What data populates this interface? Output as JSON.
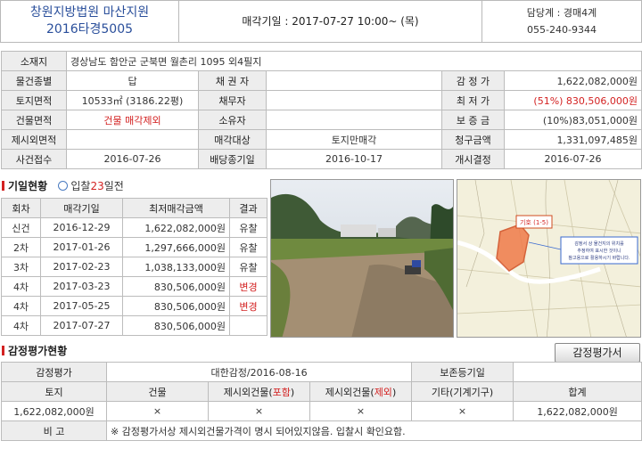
{
  "header": {
    "court": "창원지방법원 마산지원",
    "case_no": "2016타경5005",
    "sale_date": "매각기일 : 2017-07-27   10:00~ (목)",
    "dept": "담당계 : 경매4계",
    "phone": "055-240-9344"
  },
  "property": {
    "address_label": "소재지",
    "address": "경상남도 함안군 군북면 월촌리 1095 외4필지",
    "rows": [
      {
        "l1": "물건종별",
        "v1": "답",
        "l2": "채 권 자",
        "v2": "",
        "l3": "감 정 가",
        "v3": "1,622,082,000원"
      },
      {
        "l1": "토지면적",
        "v1": "10533㎡ (3186.22평)",
        "l2": "채무자",
        "v2": "",
        "l3": "최 저 가",
        "v3": "(51%) 830,506,000원"
      },
      {
        "l1": "건물면적",
        "v1": "건물 매각제외",
        "l2": "소유자",
        "v2": "",
        "l3": "보 증 금",
        "v3": "(10%)83,051,000원"
      },
      {
        "l1": "제시외면적",
        "v1": "",
        "l2": "매각대상",
        "v2": "토지만매각",
        "l3": "청구금액",
        "v3": "1,331,097,485원"
      },
      {
        "l1": "사건접수",
        "v1": "2016-07-26",
        "l2": "배당종기일",
        "v2": "2016-10-17",
        "l3": "개시결정",
        "v3": "2016-07-26"
      }
    ]
  },
  "history": {
    "title": "기일현황",
    "days_prefix": "입찰",
    "days_num": "23",
    "days_suffix": "일전",
    "headers": [
      "회차",
      "매각기일",
      "최저매각금액",
      "결과"
    ],
    "rows": [
      {
        "round": "신건",
        "date": "2016-12-29",
        "price": "1,622,082,000원",
        "result": "유찰"
      },
      {
        "round": "2차",
        "date": "2017-01-26",
        "price": "1,297,666,000원",
        "result": "유찰"
      },
      {
        "round": "3차",
        "date": "2017-02-23",
        "price": "1,038,133,000원",
        "result": "유찰"
      },
      {
        "round": "4차",
        "date": "2017-03-23",
        "price": "830,506,000원",
        "result": "변경"
      },
      {
        "round": "4차",
        "date": "2017-05-25",
        "price": "830,506,000원",
        "result": "변경"
      },
      {
        "round": "4차",
        "date": "2017-07-27",
        "price": "830,506,000원",
        "result": ""
      }
    ]
  },
  "map_labels": {
    "tag": "기호 (1-5)",
    "note1": "감정서 상 물건지의 위치를",
    "note2": "추정하여 표시한 것이니",
    "note3": "참고용으로 활용하시기 바랍니다."
  },
  "appraisal": {
    "title": "감정평가현황",
    "button": "감정평가서",
    "label": "감정평가",
    "org": "대한감정/2016-08-16",
    "reg_label": "보존등기일",
    "reg_value": "",
    "cols": {
      "land": "토지",
      "building": "건물",
      "incl_pre": "제시외건물(",
      "incl_mid": "포함",
      "excl_pre": "제시외건물(",
      "excl_mid": "제외",
      "close": ")",
      "other": "기타(기계기구)",
      "total": "합계"
    },
    "values": [
      "1,622,082,000원",
      "×",
      "×",
      "×",
      "×",
      "1,622,082,000원"
    ],
    "note_label": "비 고",
    "note": "※ 감정평가서상 제시외건물가격이 명시 되어있지않음. 입찰시 확인요함."
  },
  "colors": {
    "accent_red": "#d32222",
    "court_blue": "#2a4f9b",
    "label_bg": "#ededed"
  }
}
